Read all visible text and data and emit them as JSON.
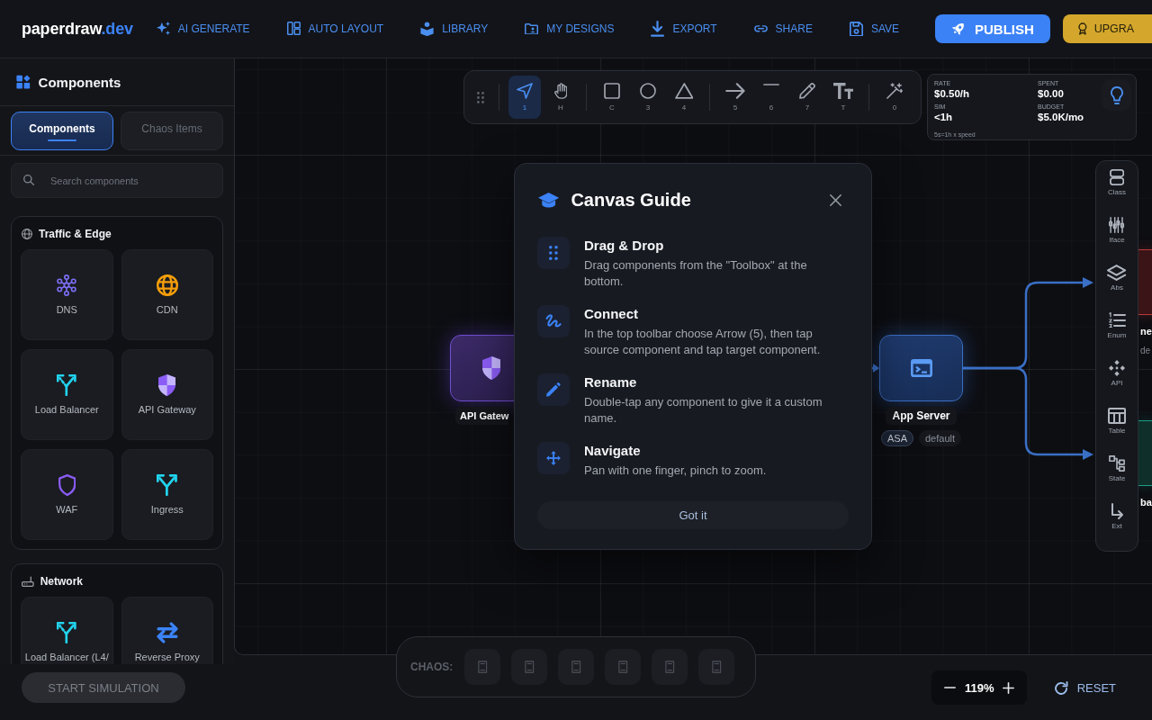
{
  "top_bar": {
    "logo": {
      "text": "paperdraw",
      "suffix": ".dev"
    },
    "nav": [
      {
        "label": "AI GENERATE",
        "kind": "generate"
      },
      {
        "label": "AUTO LAYOUT",
        "kind": "layout"
      },
      {
        "label": "LIBRARY",
        "kind": "library"
      },
      {
        "label": "MY DESIGNS",
        "kind": "designs"
      },
      {
        "label": "EXPORT",
        "kind": "export"
      },
      {
        "label": "SHARE",
        "kind": "share"
      },
      {
        "label": "SAVE",
        "kind": "save"
      }
    ],
    "publish_button": {
      "label": "PUBLISH"
    },
    "upgrade_button": {
      "label": "UPGRA"
    }
  },
  "sidebar": {
    "title": "Components",
    "tabs": [
      {
        "label": "Components",
        "selected": true
      },
      {
        "label": "Chaos Items",
        "selected": false
      }
    ],
    "search": {
      "placeholder": "Search components"
    },
    "sections": [
      {
        "title": "Traffic & Edge",
        "kind": "globe",
        "items": [
          {
            "label": "DNS",
            "kind": "dns"
          },
          {
            "label": "CDN",
            "kind": "cdn"
          },
          {
            "label": "Load Balancer",
            "kind": "balancer"
          },
          {
            "label": "API Gateway",
            "kind": "gateway"
          },
          {
            "label": "WAF",
            "kind": "waf"
          },
          {
            "label": "Ingress",
            "kind": "ingress"
          }
        ]
      },
      {
        "title": "Network",
        "kind": "router",
        "items": [
          {
            "label": "Load Balancer (L4/",
            "kind": "balancer"
          },
          {
            "label": "Reverse Proxy",
            "kind": "proxy"
          }
        ]
      }
    ]
  },
  "canvas": {
    "toolbar": {
      "groups": [
        {
          "tools": [
            {
              "kind": "select",
              "key": "1",
              "selected": true
            },
            {
              "kind": "hand",
              "key": "H",
              "selected": false
            }
          ]
        },
        {
          "tools": [
            {
              "kind": "rectangle",
              "key": "C",
              "selected": false
            },
            {
              "kind": "circle",
              "key": "3",
              "selected": false
            },
            {
              "kind": "triangle",
              "key": "4",
              "selected": false
            }
          ]
        },
        {
          "tools": [
            {
              "kind": "arrow",
              "key": "5",
              "selected": false
            },
            {
              "kind": "line",
              "key": "6",
              "selected": false
            },
            {
              "kind": "pencil",
              "key": "7",
              "selected": false
            },
            {
              "kind": "text",
              "key": "T",
              "selected": false
            }
          ]
        },
        {
          "tools": [
            {
              "kind": "magic",
              "key": "0",
              "selected": false
            }
          ]
        }
      ]
    },
    "cost_panel": {
      "metrics": [
        {
          "label": "RATE",
          "value": "$0.50/h"
        },
        {
          "label": "SPENT",
          "value": "$0.00"
        },
        {
          "label": "SIM",
          "value": "<1h"
        },
        {
          "label": "BUDGET",
          "value": "$5.0K/mo"
        }
      ],
      "note": "5s=1h x speed"
    },
    "nodes": [
      {
        "kind": "gateway",
        "label": "API Gatew"
      },
      {
        "kind": "server",
        "label": "App Server",
        "tags": [
          {
            "label": "ASA",
            "kind": "outlined"
          },
          {
            "label": "default",
            "kind": "plain"
          }
        ]
      },
      {
        "kind": "danger",
        "label": "ne",
        "sublabel": "de"
      },
      {
        "kind": "success",
        "label": "ba"
      }
    ],
    "side_toolbar": [
      {
        "label": "Class",
        "kind": "class"
      },
      {
        "label": "Iface",
        "kind": "iface"
      },
      {
        "label": "Abs",
        "kind": "abs"
      },
      {
        "label": "Enum",
        "kind": "enum"
      },
      {
        "label": "API",
        "kind": "api"
      },
      {
        "label": "Table",
        "kind": "table"
      },
      {
        "label": "State",
        "kind": "state"
      },
      {
        "label": "Ext",
        "kind": "ext"
      }
    ],
    "guide": {
      "title": "Canvas Guide",
      "steps": [
        {
          "kind": "drag",
          "title": "Drag & Drop",
          "text": "Drag components from the \"Toolbox\" at the bottom."
        },
        {
          "kind": "connect",
          "title": "Connect",
          "text": "In the top toolbar choose Arrow (5), then tap source component and tap target component."
        },
        {
          "kind": "rename",
          "title": "Rename",
          "text": "Double-tap any component to give it a custom name."
        },
        {
          "kind": "navigate",
          "title": "Navigate",
          "text": "Pan with one finger, pinch to zoom."
        }
      ],
      "button": "Got it"
    }
  },
  "bottom_bar": {
    "start_button": {
      "label": "START SIMULATION",
      "disabled": true
    },
    "chaos": {
      "label": "CHAOS:",
      "items": [
        {
          "kind": "glyph"
        },
        {
          "kind": "glyph"
        },
        {
          "kind": "glyph"
        },
        {
          "kind": "glyph"
        },
        {
          "kind": "glyph"
        },
        {
          "kind": "glyph"
        }
      ]
    },
    "zoom": {
      "value": "119%"
    },
    "reset_button": {
      "label": "RESET"
    }
  }
}
